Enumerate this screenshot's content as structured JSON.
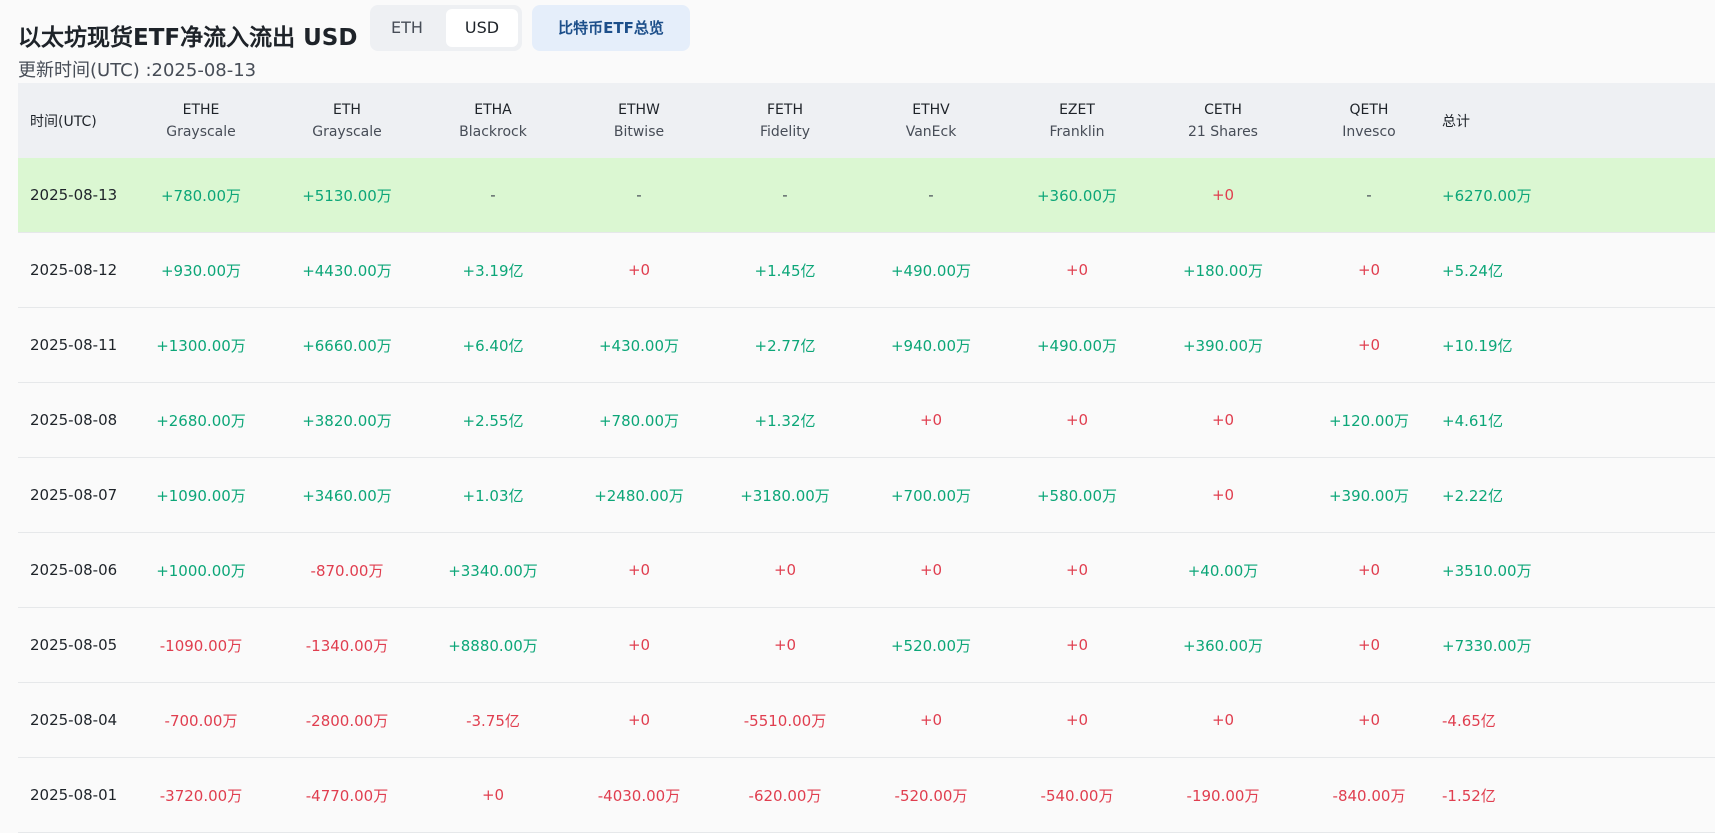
{
  "header": {
    "title": "以太坊现货ETF净流入流出 USD",
    "toggle": {
      "eth_label": "ETH",
      "usd_label": "USD"
    },
    "btc_overview_label": "比特币ETF总览",
    "updated": "更新时间(UTC) :2025-08-13"
  },
  "table": {
    "date_header": "时间(UTC)",
    "total_header": "总计",
    "columns": [
      {
        "code": "ETHE",
        "issuer": "Grayscale"
      },
      {
        "code": "ETH",
        "issuer": "Grayscale"
      },
      {
        "code": "ETHA",
        "issuer": "Blackrock"
      },
      {
        "code": "ETHW",
        "issuer": "Bitwise"
      },
      {
        "code": "FETH",
        "issuer": "Fidelity"
      },
      {
        "code": "ETHV",
        "issuer": "VanEck"
      },
      {
        "code": "EZET",
        "issuer": "Franklin"
      },
      {
        "code": "CETH",
        "issuer": "21 Shares"
      },
      {
        "code": "QETH",
        "issuer": "Invesco"
      }
    ],
    "rows": [
      {
        "date": "2025-08-13",
        "values": [
          "+780.00万",
          "+5130.00万",
          "-",
          "-",
          "-",
          "-",
          "+360.00万",
          "+0",
          "-"
        ],
        "total": "+6270.00万"
      },
      {
        "date": "2025-08-12",
        "values": [
          "+930.00万",
          "+4430.00万",
          "+3.19亿",
          "+0",
          "+1.45亿",
          "+490.00万",
          "+0",
          "+180.00万",
          "+0"
        ],
        "total": "+5.24亿"
      },
      {
        "date": "2025-08-11",
        "values": [
          "+1300.00万",
          "+6660.00万",
          "+6.40亿",
          "+430.00万",
          "+2.77亿",
          "+940.00万",
          "+490.00万",
          "+390.00万",
          "+0"
        ],
        "total": "+10.19亿"
      },
      {
        "date": "2025-08-08",
        "values": [
          "+2680.00万",
          "+3820.00万",
          "+2.55亿",
          "+780.00万",
          "+1.32亿",
          "+0",
          "+0",
          "+0",
          "+120.00万"
        ],
        "total": "+4.61亿"
      },
      {
        "date": "2025-08-07",
        "values": [
          "+1090.00万",
          "+3460.00万",
          "+1.03亿",
          "+2480.00万",
          "+3180.00万",
          "+700.00万",
          "+580.00万",
          "+0",
          "+390.00万"
        ],
        "total": "+2.22亿"
      },
      {
        "date": "2025-08-06",
        "values": [
          "+1000.00万",
          "-870.00万",
          "+3340.00万",
          "+0",
          "+0",
          "+0",
          "+0",
          "+40.00万",
          "+0"
        ],
        "total": "+3510.00万"
      },
      {
        "date": "2025-08-05",
        "values": [
          "-1090.00万",
          "-1340.00万",
          "+8880.00万",
          "+0",
          "+0",
          "+520.00万",
          "+0",
          "+360.00万",
          "+0"
        ],
        "total": "+7330.00万"
      },
      {
        "date": "2025-08-04",
        "values": [
          "-700.00万",
          "-2800.00万",
          "-3.75亿",
          "+0",
          "-5510.00万",
          "+0",
          "+0",
          "+0",
          "+0"
        ],
        "total": "-4.65亿"
      },
      {
        "date": "2025-08-01",
        "values": [
          "-3720.00万",
          "-4770.00万",
          "+0",
          "-4030.00万",
          "-620.00万",
          "-520.00万",
          "-540.00万",
          "-190.00万",
          "-840.00万"
        ],
        "total": "-1.52亿"
      }
    ]
  },
  "colors": {
    "positive": "#0ca678",
    "negative": "#e03e4f",
    "highlight_row": "#dbf7d2",
    "header_bg": "#eef0f3"
  }
}
